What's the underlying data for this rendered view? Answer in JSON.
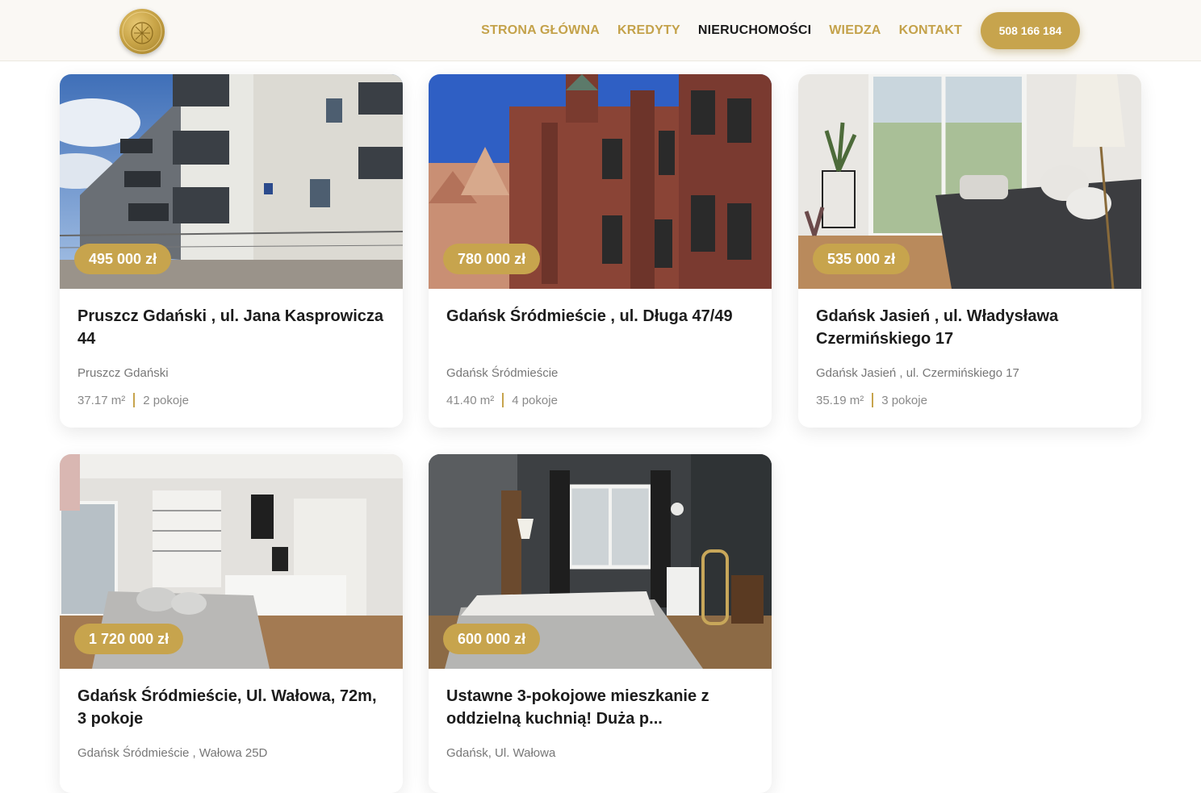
{
  "header": {
    "nav": [
      "STRONA GŁÓWNA",
      "KREDYTY",
      "NIERUCHOMOŚCI",
      "WIEDZA",
      "KONTAKT"
    ],
    "active_nav": "NIERUCHOMOŚCI",
    "phone": "508 166 184"
  },
  "listings": [
    {
      "price": "495 000 zł",
      "title": "Pruszcz Gdański , ul. Jana Kasprowicza 44",
      "location": "Pruszcz Gdański",
      "area": "37.17 m²",
      "rooms": "2 pokoje"
    },
    {
      "price": "780 000 zł",
      "title": "Gdańsk Śródmieście , ul. Długa 47/49",
      "location": "Gdańsk Śródmieście",
      "area": "41.40 m²",
      "rooms": "4 pokoje"
    },
    {
      "price": "535 000 zł",
      "title": "Gdańsk Jasień , ul. Władysława Czermińskiego 17",
      "location": "Gdańsk Jasień , ul. Czermińskiego 17",
      "area": "35.19 m²",
      "rooms": "3 pokoje"
    },
    {
      "price": "1 720 000 zł",
      "title": "Gdańsk Śródmieście, Ul. Wałowa, 72m, 3 pokoje",
      "location": "Gdańsk Śródmieście , Wałowa 25D",
      "area": "",
      "rooms": ""
    },
    {
      "price": "600 000 zł",
      "title": "Ustawne 3-pokojowe mieszkanie z oddzielną kuchnią! Duża p...",
      "location": "Gdańsk, Ul. Wałowa",
      "area": "",
      "rooms": ""
    }
  ],
  "colors": {
    "accent": "#c7a44d",
    "nav_inactive": "#c4a24a",
    "nav_active": "#1a1a1a"
  }
}
